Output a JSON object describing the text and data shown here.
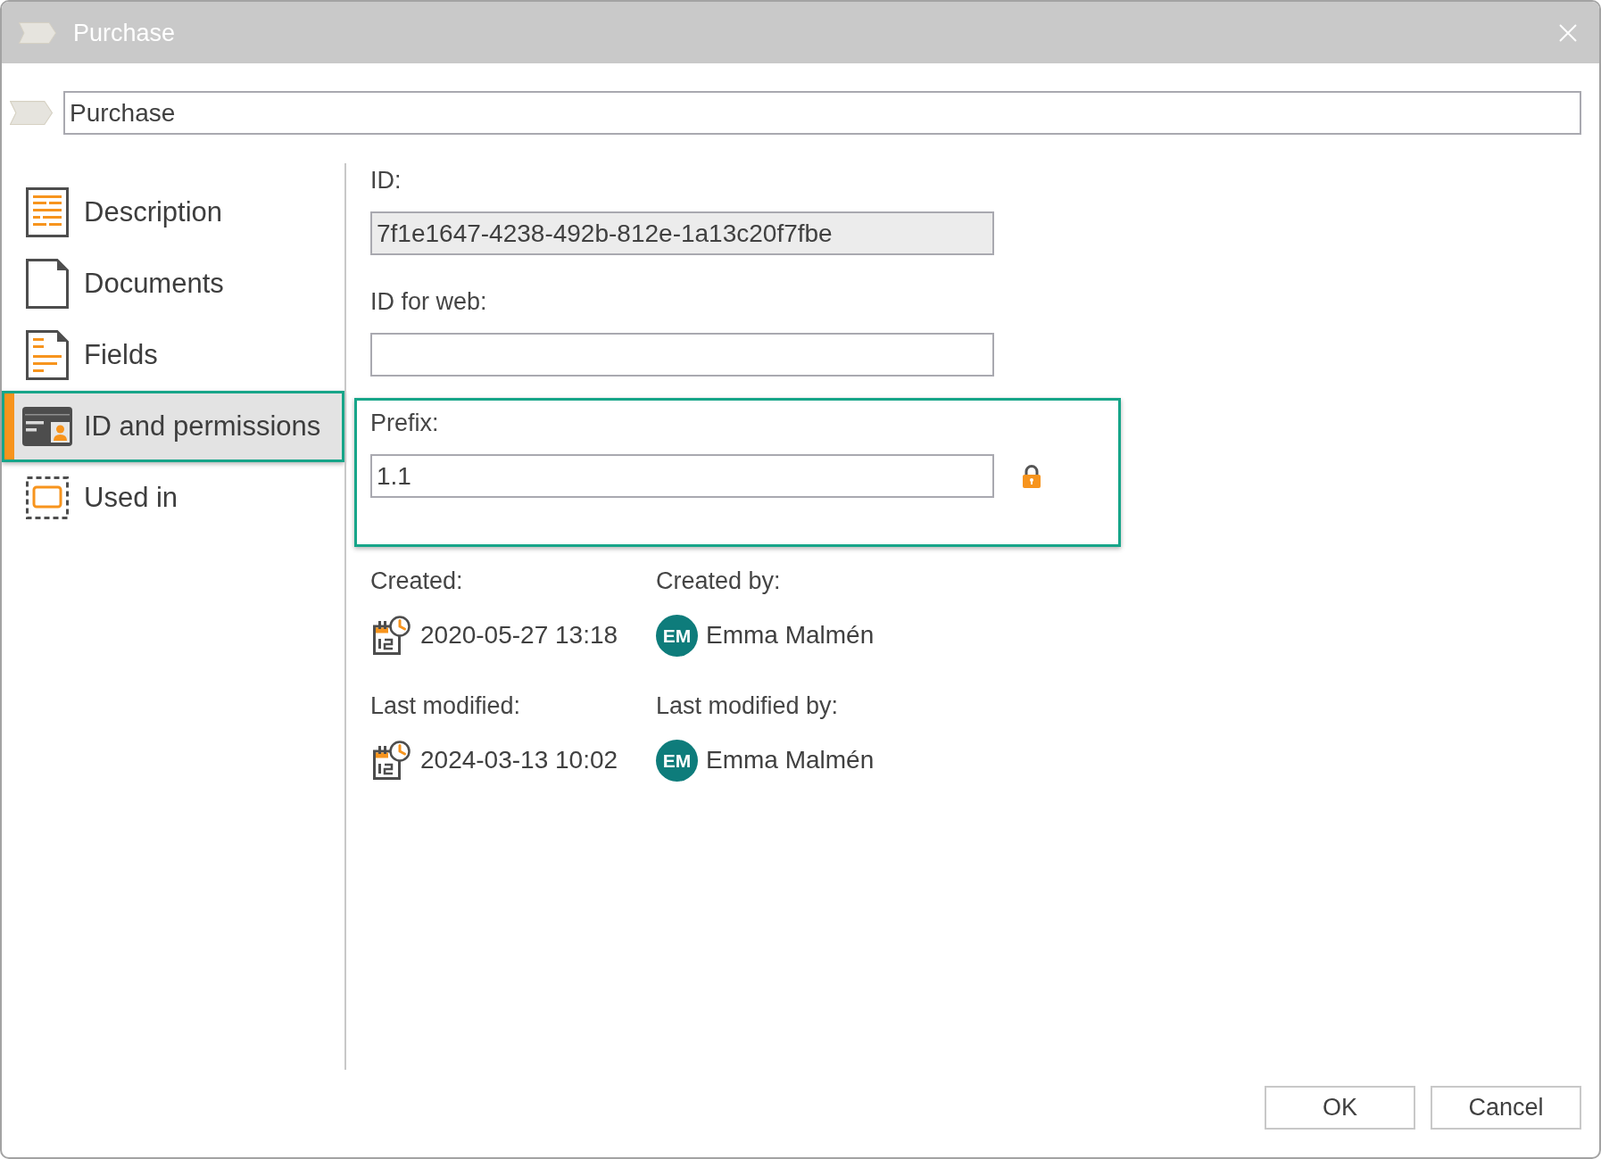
{
  "window": {
    "title": "Purchase"
  },
  "name_field": {
    "value": "Purchase"
  },
  "sidebar": {
    "items": [
      {
        "label": "Description",
        "kind": "description",
        "selected": false,
        "highlighted": false
      },
      {
        "label": "Documents",
        "kind": "documents",
        "selected": false,
        "highlighted": false
      },
      {
        "label": "Fields",
        "kind": "fields",
        "selected": false,
        "highlighted": false
      },
      {
        "label": "ID and permissions",
        "kind": "id_card",
        "selected": true,
        "highlighted": true
      },
      {
        "label": "Used in",
        "kind": "used_in",
        "selected": false,
        "highlighted": false
      }
    ]
  },
  "fields": [
    {
      "label": "ID:",
      "value": "7f1e1647-4238-492b-812e-1a13c20f7fbe",
      "disabled": true,
      "highlighted": false
    },
    {
      "label": "ID for web:",
      "disabled": false,
      "highlighted": false
    },
    {
      "label": "Prefix:",
      "value": "1.1",
      "disabled": false,
      "highlighted": true,
      "locked": true
    }
  ],
  "history": [
    {
      "label": "Created:",
      "value": "2020-05-27 13:18",
      "by_label": "Created by:",
      "user": {
        "initials": "EM",
        "name": "Emma Malmén"
      }
    },
    {
      "label": "Last modified:",
      "value": "2024-03-13 10:02",
      "by_label": "Last modified by:",
      "user": {
        "initials": "EM",
        "name": "Emma Malmén"
      }
    }
  ],
  "buttons": [
    "OK",
    "Cancel"
  ]
}
